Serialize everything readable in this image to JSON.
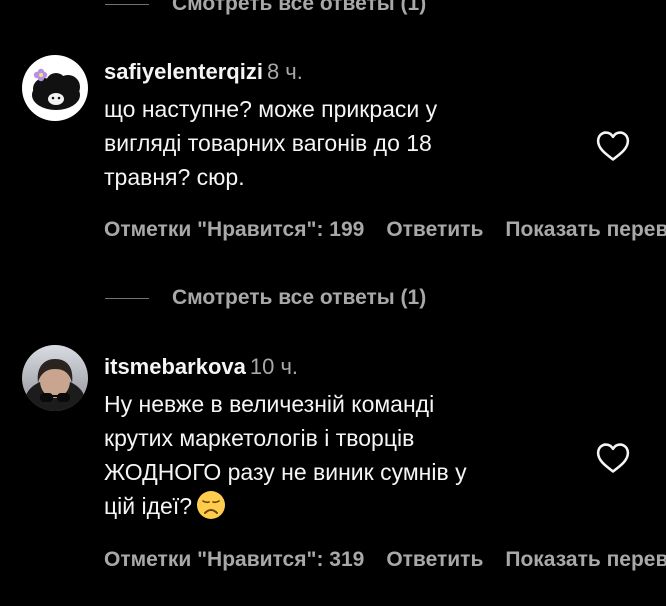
{
  "colors": {
    "background": "#000000",
    "primary_text": "#f5f5f5",
    "secondary_text": "#a8a8a8",
    "divider": "#737373"
  },
  "top_view_replies": {
    "label": "Смотреть все ответы (1)"
  },
  "comments": [
    {
      "username": "safiyelenterqizi",
      "time": "8 ч.",
      "text_lines": [
        "що наступне? може прикраси у",
        "вигляді товарних вагонів до 18",
        "травня? сюр."
      ],
      "likes_label": "Отметки \"Нравится\": 199",
      "reply_label": "Ответить",
      "translate_label": "Показать перевод",
      "like_icon": "heart-outline-icon",
      "view_replies_label": "Смотреть все ответы (1)"
    },
    {
      "username": "itsmebarkova",
      "time": "10 ч.",
      "text_lines": [
        "Ну невже в величезній команді",
        "крутих маркетологів і творців",
        "ЖОДНОГО разу не виник сумнів у",
        "цій ідеї?"
      ],
      "emoji": "disappointed-face-emoji",
      "likes_label": "Отметки \"Нравится\": 319",
      "reply_label": "Ответить",
      "translate_label": "Показать перевод",
      "like_icon": "heart-outline-icon"
    }
  ]
}
